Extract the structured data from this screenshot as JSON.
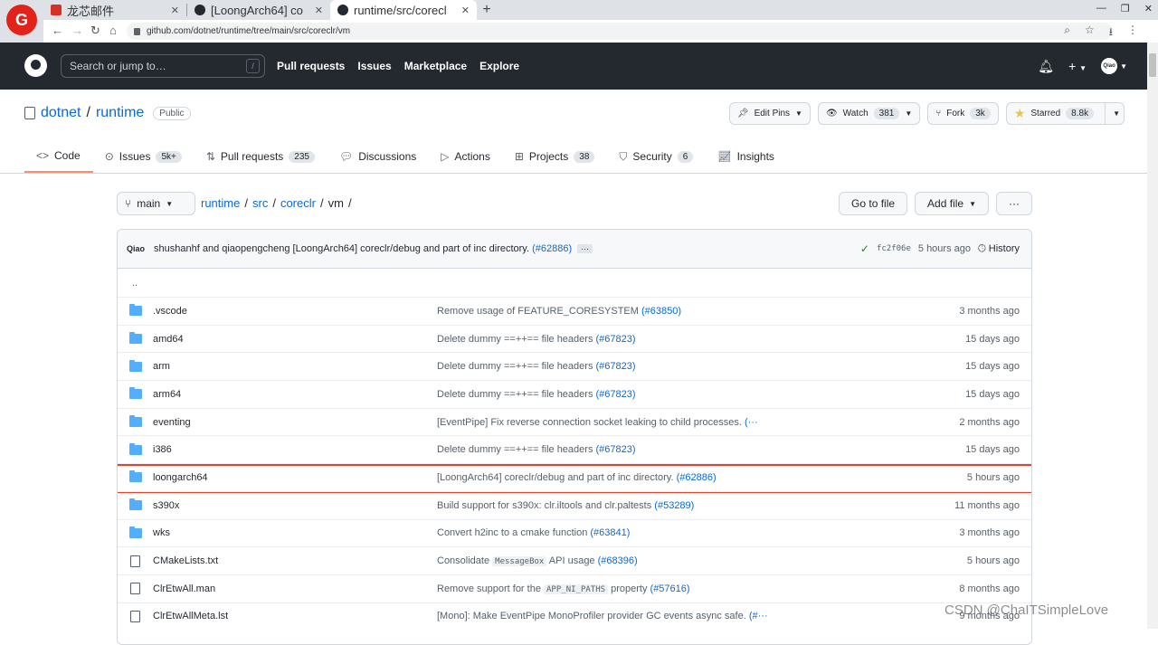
{
  "browser": {
    "logo_glyph": "G",
    "tabs": [
      {
        "title": "龙芯邮件",
        "favicon_color": "#d93025"
      },
      {
        "title": "[LoongArch64] co",
        "favicon_color": "#24292f"
      },
      {
        "title": "runtime/src/corecl",
        "favicon_color": "#24292f"
      }
    ],
    "url": "github.com/dotnet/runtime/tree/main/src/coreclr/vm"
  },
  "gh": {
    "search_placeholder": "Search or jump to…",
    "search_key": "/",
    "nav": [
      "Pull requests",
      "Issues",
      "Marketplace",
      "Explore"
    ],
    "avatar_text": "Qiao"
  },
  "repo": {
    "owner": "dotnet",
    "name": "runtime",
    "visibility": "Public",
    "edit_pins": "Edit Pins",
    "watch_label": "Watch",
    "watch_count": "381",
    "fork_label": "Fork",
    "fork_count": "3k",
    "star_label": "Starred",
    "star_count": "8.8k"
  },
  "tabs": [
    {
      "label": "Code",
      "icon": "code-icon",
      "count": ""
    },
    {
      "label": "Issues",
      "icon": "issue-icon",
      "count": "5k+"
    },
    {
      "label": "Pull requests",
      "icon": "pull-request-icon",
      "count": "235"
    },
    {
      "label": "Discussions",
      "icon": "discussion-icon",
      "count": ""
    },
    {
      "label": "Actions",
      "icon": "play-icon",
      "count": ""
    },
    {
      "label": "Projects",
      "icon": "table-icon",
      "count": "38"
    },
    {
      "label": "Security",
      "icon": "shield-icon",
      "count": "6"
    },
    {
      "label": "Insights",
      "icon": "graph-icon",
      "count": ""
    }
  ],
  "filenav": {
    "branch": "main",
    "path": [
      "runtime",
      "src",
      "coreclr"
    ],
    "current": "vm",
    "go_to_file": "Go to file",
    "add_file": "Add file",
    "more": "···"
  },
  "commit": {
    "avatar": "Qiao",
    "authors": "shushanhf and qiaopengcheng",
    "message": "[LoongArch64] coreclr/debug and part of inc directory.",
    "pr": "(#62886)",
    "sha": "fc2f06e",
    "time": "5 hours ago",
    "history": "History"
  },
  "parent_dir": "..",
  "files": [
    {
      "type": "dir",
      "name": ".vscode",
      "msg": "Remove usage of FEATURE_CORESYSTEM",
      "pr": "(#63850)",
      "age": "3 months ago"
    },
    {
      "type": "dir",
      "name": "amd64",
      "msg": "Delete dummy ==++== file headers",
      "pr": "(#67823)",
      "age": "15 days ago"
    },
    {
      "type": "dir",
      "name": "arm",
      "msg": "Delete dummy ==++== file headers",
      "pr": "(#67823)",
      "age": "15 days ago"
    },
    {
      "type": "dir",
      "name": "arm64",
      "msg": "Delete dummy ==++== file headers",
      "pr": "(#67823)",
      "age": "15 days ago"
    },
    {
      "type": "dir",
      "name": "eventing",
      "msg": "[EventPipe] Fix reverse connection socket leaking to child processes.",
      "pr": "(···",
      "age": "2 months ago"
    },
    {
      "type": "dir",
      "name": "i386",
      "msg": "Delete dummy ==++== file headers",
      "pr": "(#67823)",
      "age": "15 days ago"
    },
    {
      "type": "dir",
      "name": "loongarch64",
      "msg": "[LoongArch64] coreclr/debug and part of inc directory.",
      "pr": "(#62886)",
      "age": "5 hours ago",
      "highlight": true
    },
    {
      "type": "dir",
      "name": "s390x",
      "msg": "Build support for s390x: clr.iltools and clr.paltests",
      "pr": "(#53289)",
      "age": "11 months ago"
    },
    {
      "type": "dir",
      "name": "wks",
      "msg": "Convert h2inc to a cmake function",
      "pr": "(#63841)",
      "age": "3 months ago"
    },
    {
      "type": "file",
      "name": "CMakeLists.txt",
      "msg": "Consolidate",
      "code": "MessageBox",
      "msg2": "API usage",
      "pr": "(#68396)",
      "age": "5 hours ago"
    },
    {
      "type": "file",
      "name": "ClrEtwAll.man",
      "msg": "Remove support for the",
      "code": "APP_NI_PATHS",
      "msg2": "property",
      "pr": "(#57616)",
      "age": "8 months ago"
    },
    {
      "type": "file",
      "name": "ClrEtwAllMeta.lst",
      "msg": "[Mono]: Make EventPipe MonoProfiler provider GC events async safe.",
      "pr": "(#···",
      "age": "9 months ago"
    }
  ],
  "watermark": "CSDN @ChaITSimpleLove"
}
